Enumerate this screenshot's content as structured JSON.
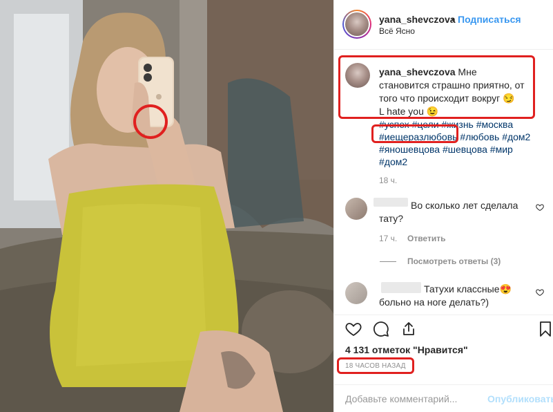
{
  "header": {
    "username": "yana_shevczova",
    "separator": "•",
    "follow_label": "Подписаться",
    "subtitle": "Всё Ясно"
  },
  "caption": {
    "username": "yana_shevczova",
    "line1": "Мне становится страшно приятно, от того что происходит вокруг",
    "emoji1": "😏",
    "line2": "L hate you",
    "emoji2": "😉",
    "tags_row1": "#успех #цели #жизнь #москва",
    "tags_row2_highlight": "#иещеразлюбовь",
    "tags_row2_rest": "#любовь #дом2",
    "tags_row3": "#яношевцова #шевцова #мир",
    "tags_row4": "#дом2",
    "time": "18 ч."
  },
  "comments": [
    {
      "text": "Во сколько лет сделала тату?",
      "time": "17 ч.",
      "reply_label": "Ответить"
    },
    {
      "text": "Татухи классные😍 больно на ноге делать?)"
    }
  ],
  "view_replies": "Посмотреть ответы (3)",
  "likes": "4 131 отметок \"Нравится\"",
  "time_ago": "18 часов назад",
  "add_comment": {
    "placeholder": "Добавьте комментарий...",
    "post_label": "Опубликовать"
  },
  "colors": {
    "accent": "#3897f0",
    "highlight_box": "#e0201f",
    "hashtag": "#003569",
    "muted": "#8e8e8e"
  },
  "icons": [
    "heart-icon",
    "comment-icon",
    "share-icon",
    "bookmark-icon",
    "heart-small-icon"
  ]
}
